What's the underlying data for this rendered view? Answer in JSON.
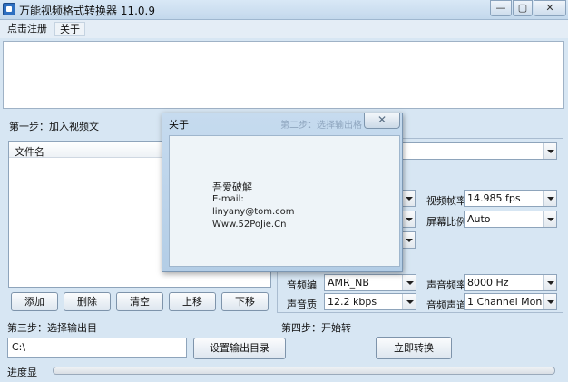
{
  "window": {
    "title": "万能视频格式转换器 11.0.9",
    "minimize": "—",
    "maximize": "▢",
    "close": "✕"
  },
  "menu": {
    "register": "点击注册",
    "about": "关于"
  },
  "step1": {
    "label": "第一步：加入视频文",
    "list_header": "文件名",
    "buttons": {
      "add": "添加",
      "delete": "删除",
      "clear": "清空",
      "up": "上移",
      "down": "下移"
    }
  },
  "settings": {
    "top_combo": "",
    "frame_rate": {
      "label": "视频帧率",
      "value": "14.985 fps"
    },
    "aspect_ratio": {
      "label": "屏幕比例",
      "value": "Auto"
    },
    "audio_codec": {
      "label": "音频编",
      "value": "AMR_NB"
    },
    "audio_quality": {
      "label": "声音质",
      "value": "12.2 kbps"
    },
    "sample_rate": {
      "label": "声音频率",
      "value": "8000 Hz"
    },
    "channels": {
      "label": "音频声道",
      "value": "1 Channel Mono"
    }
  },
  "step3": {
    "label": "第三步：选择输出目",
    "output_path": "C:\\",
    "set_output_button": "设置输出目录"
  },
  "step4": {
    "label": "第四步：开始转",
    "convert_button": "立即转换"
  },
  "progress": {
    "label": "进度显",
    "value": 0
  },
  "about_dialog": {
    "title": "关于",
    "behind_text": "第二步：选择输出格",
    "close": "✕",
    "lines": [
      "吾爱破解",
      "E-mail:",
      "linyany@tom.com",
      "Www.52PoJie.Cn"
    ]
  }
}
